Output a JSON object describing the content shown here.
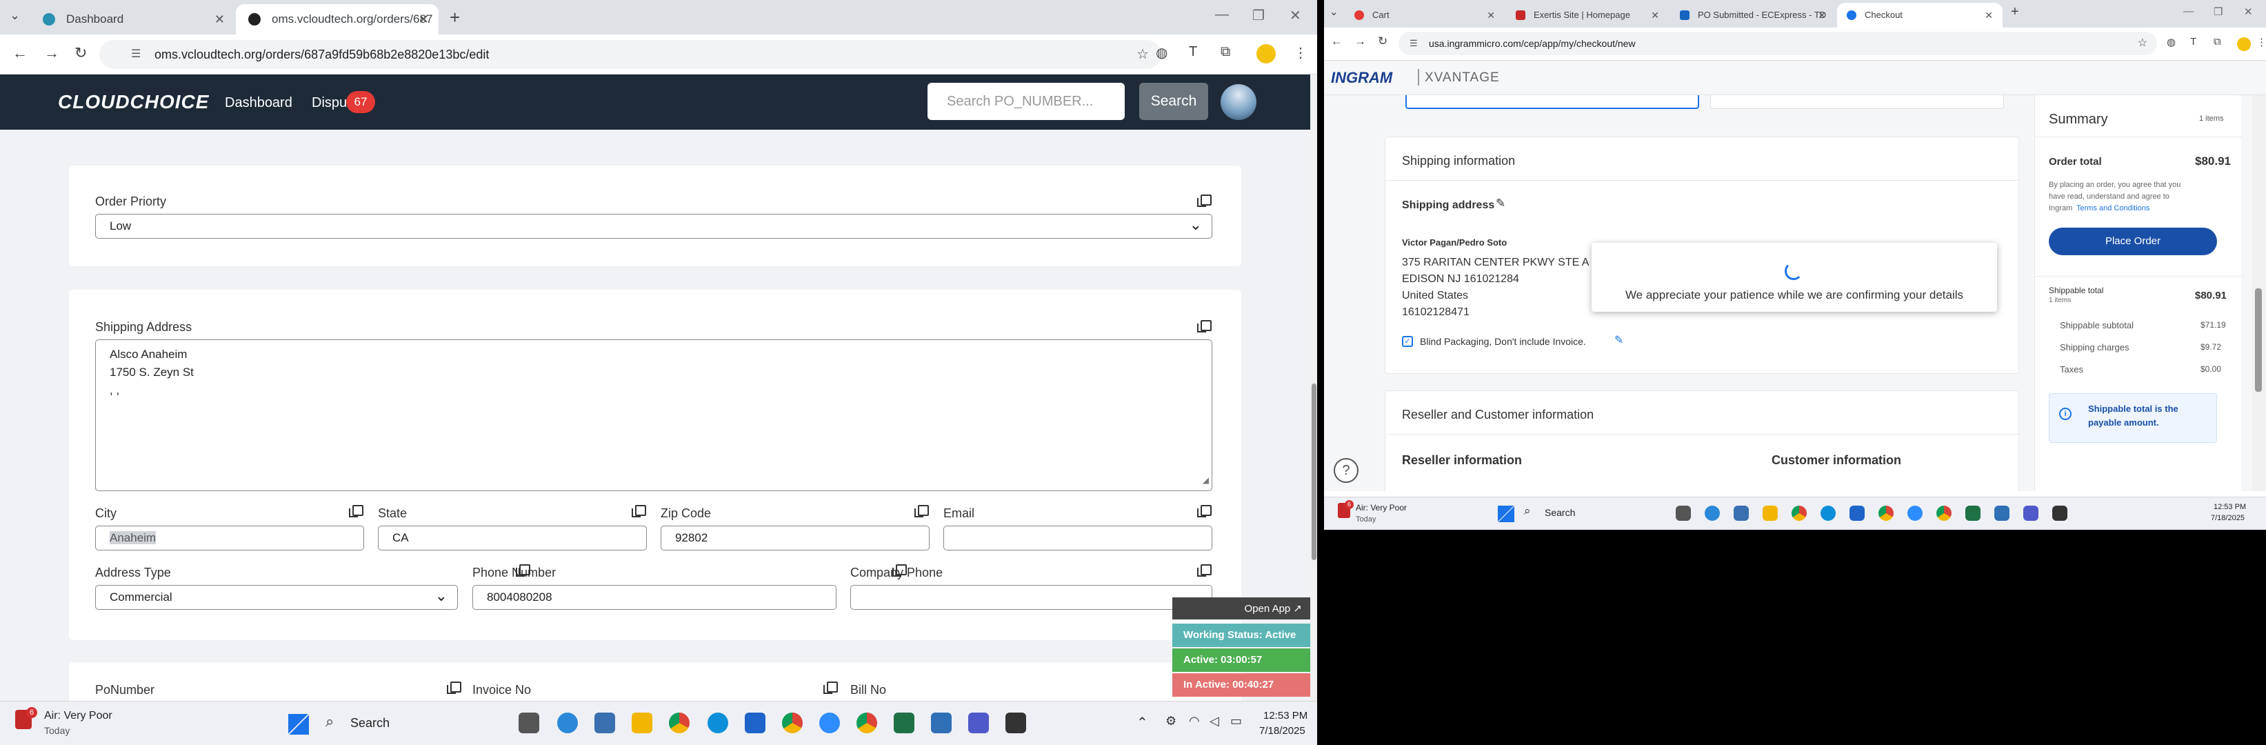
{
  "left_browser": {
    "tabs": [
      {
        "title": "Dashboard",
        "active": false
      },
      {
        "title": "oms.vcloudtech.org/orders/687",
        "active": true
      }
    ],
    "url": "oms.vcloudtech.org/orders/687a9fd59b68b2e8820e13bc/edit"
  },
  "app": {
    "logo": "CLOUDCHOICE",
    "nav": [
      "Dashboard",
      "Dispu"
    ],
    "badge": "67",
    "search_placeholder": "Search PO_NUMBER...",
    "search_button": "Search"
  },
  "form": {
    "order_priority": {
      "label": "Order Priorty",
      "value": "Low"
    },
    "shipping_address": {
      "label": "Shipping Address",
      "lines": [
        "Alsco Anaheim",
        "1750 S. Zeyn St",
        ", ,"
      ]
    },
    "city": {
      "label": "City",
      "value": "Anaheim"
    },
    "state": {
      "label": "State",
      "value": "CA"
    },
    "zip": {
      "label": "Zip Code",
      "value": "92802"
    },
    "email": {
      "label": "Email",
      "value": ""
    },
    "address_type": {
      "label": "Address Type",
      "value": "Commercial"
    },
    "phone": {
      "label": "Phone Number",
      "value": "8004080208"
    },
    "company_phone": {
      "label": "Company Phone",
      "value": ""
    },
    "po_number": {
      "label": "PoNumber"
    },
    "invoice_no": {
      "label": "Invoice No"
    },
    "bill_no": {
      "label": "Bill No"
    }
  },
  "widget": {
    "open_app": "Open App ↗",
    "working_status": "Working Status: Active",
    "active": "Active: 03:00:57",
    "inactive": "In Active: 00:40:27",
    "colors": {
      "working": "#5bb5b5",
      "active": "#4caf50",
      "inactive": "#e57373"
    }
  },
  "left_taskbar": {
    "weather_badge": "6",
    "weather": "Air: Very Poor",
    "weather_sub": "Today",
    "search": "Search",
    "time": "12:53 PM",
    "date": "7/18/2025"
  },
  "right_browser": {
    "tabs": [
      {
        "title": "Cart",
        "active": false
      },
      {
        "title": "Exertis Site | Homepage",
        "active": false
      },
      {
        "title": "PO Submitted - ECExpress - TD",
        "active": false
      },
      {
        "title": "Checkout",
        "active": true
      }
    ],
    "url": "usa.ingrammicro.com/cep/app/my/checkout/new"
  },
  "ingram": {
    "logo_left": "INGRAM",
    "logo_right": "XVANTAGE",
    "shipping_information": "Shipping information",
    "shipping_address": "Shipping address",
    "address_lines": [
      "Victor Pagan/Pedro Soto",
      "375 RARITAN CENTER PKWY STE A",
      "EDISON NJ 161021284",
      "United States",
      "16102128471"
    ],
    "blind_packaging": "Blind Packaging, Don't include Invoice.",
    "reseller_customer": "Reseller and Customer information",
    "reseller_info": "Reseller information",
    "customer_info": "Customer information",
    "modal_text": "We appreciate your patience while we are confirming your details",
    "summary": {
      "title": "Summary",
      "items": "1 items",
      "order_total_label": "Order total",
      "order_total": "$80.91",
      "terms_1": "By placing an order, you agree that you",
      "terms_2": "have read, understand and agree to",
      "terms_3": "Ingram",
      "terms_link": "Terms and Conditions",
      "place_order": "Place Order",
      "shippable_total_label": "Shippable total",
      "shippable_items": "1 items",
      "shippable_total": "$80.91",
      "rows": [
        {
          "label": "Shippable subtotal",
          "value": "$71.19"
        },
        {
          "label": "Shipping charges",
          "value": "$9.72"
        },
        {
          "label": "Taxes",
          "value": "$0.00"
        }
      ],
      "note_1": "Shippable total is the",
      "note_2": "payable amount."
    }
  },
  "right_taskbar": {
    "weather_badge": "6",
    "weather": "Air: Very Poor",
    "weather_sub": "Today",
    "search": "Search",
    "time": "12:53 PM",
    "date": "7/18/2025"
  }
}
